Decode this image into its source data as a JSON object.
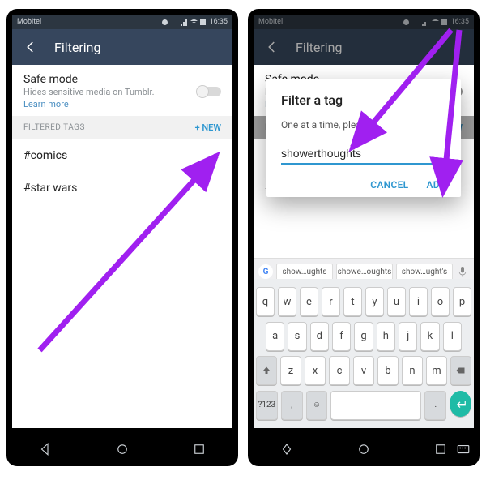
{
  "status": {
    "carrier": "Mobitel",
    "time": "16:35"
  },
  "appbar": {
    "title": "Filtering"
  },
  "safe_mode": {
    "title": "Safe mode",
    "desc": "Hides sensitive media on Tumblr.",
    "link": "Learn more"
  },
  "section": {
    "label": "FILTERED TAGS",
    "action": "+ NEW"
  },
  "tags": [
    "#comics",
    "#star wars"
  ],
  "dialog": {
    "title": "Filter a tag",
    "message": "One at a time, please.",
    "value": "showerthoughts",
    "cancel": "CANCEL",
    "add": "ADD"
  },
  "suggestions": [
    "show…ughts",
    "showe…oughts",
    "show…ught's"
  ],
  "keyboard": {
    "row1": [
      "q",
      "w",
      "e",
      "r",
      "t",
      "y",
      "u",
      "i",
      "o",
      "p"
    ],
    "row2": [
      "a",
      "s",
      "d",
      "f",
      "g",
      "h",
      "j",
      "k",
      "l"
    ],
    "row3_mid": [
      "z",
      "x",
      "c",
      "v",
      "b",
      "n",
      "m"
    ],
    "sym": "?123",
    "comma": ",",
    "period": "."
  }
}
